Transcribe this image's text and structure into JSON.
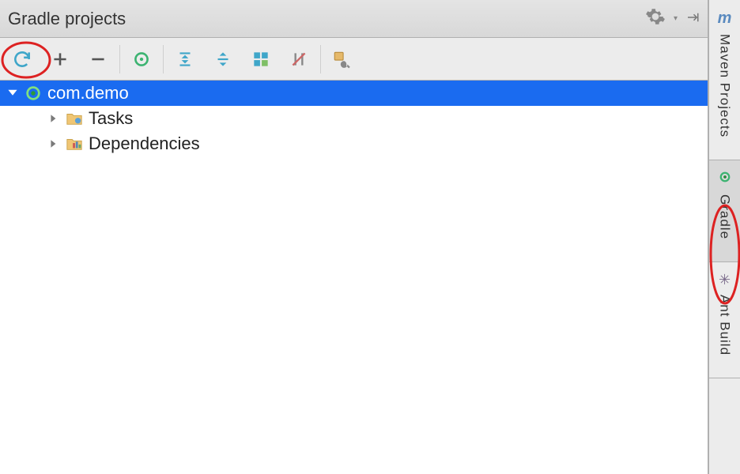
{
  "header": {
    "title": "Gradle projects"
  },
  "toolbar": {
    "buttons": [
      "refresh",
      "add",
      "remove",
      "execute",
      "expand-all",
      "collapse-all",
      "group",
      "toggle-offline",
      "settings-wrench"
    ]
  },
  "tree": {
    "root": {
      "label": "com.demo"
    },
    "children": [
      {
        "label": "Tasks",
        "icon": "tasks"
      },
      {
        "label": "Dependencies",
        "icon": "deps"
      }
    ]
  },
  "sidebar": {
    "tabs": [
      {
        "label": "Maven Projects",
        "icon": "maven",
        "active": false
      },
      {
        "label": "Gradle",
        "icon": "gradle",
        "active": true
      },
      {
        "label": "Ant Build",
        "icon": "ant",
        "active": false
      }
    ]
  }
}
